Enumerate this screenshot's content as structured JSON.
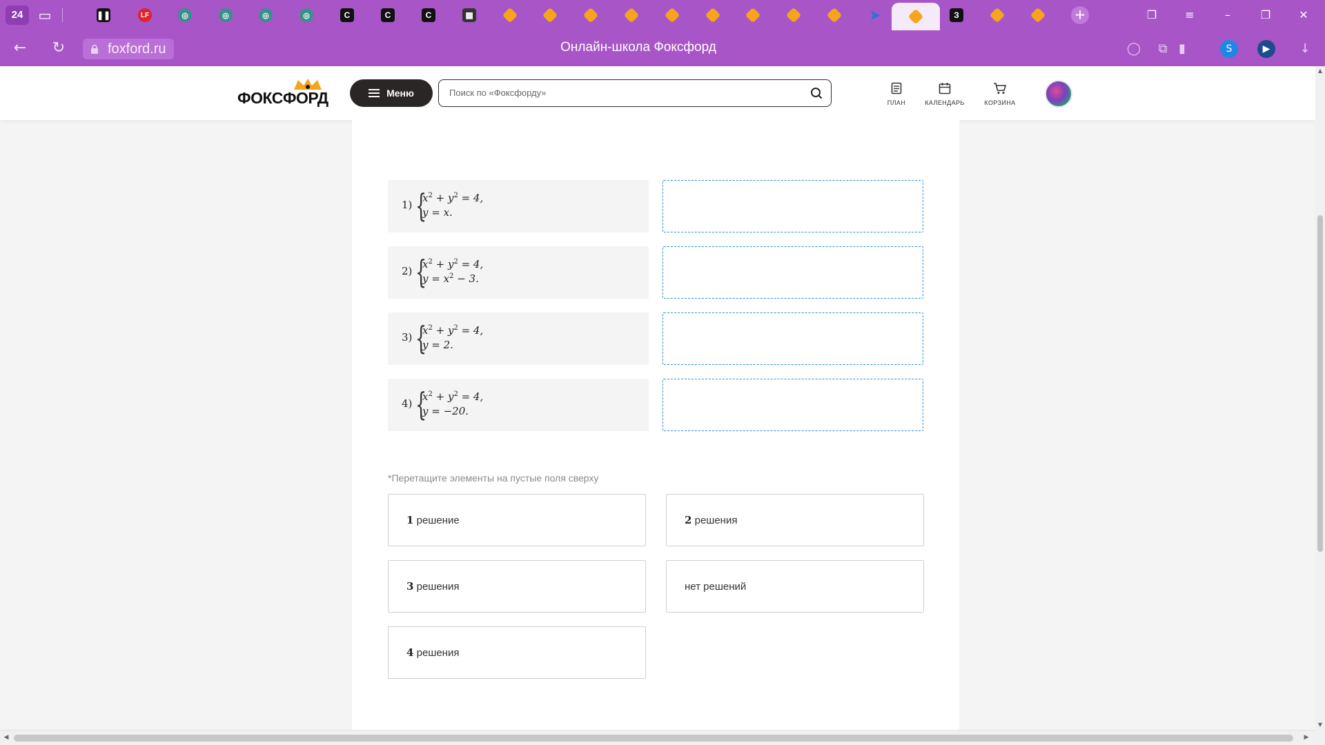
{
  "browser": {
    "tab_count": "24",
    "favicon_letters": {
      "lf": "LF",
      "c": "C",
      "z": "З"
    },
    "url": "foxford.ru",
    "page_title": "Онлайн-школа Фоксфорд"
  },
  "site": {
    "logo_text": "ФОКСФОРД",
    "menu_label": "Меню",
    "search_placeholder": "Поиск по «Фоксфорду»",
    "nav": {
      "plan": "ПЛАН",
      "calendar": "КАЛЕНДАРЬ",
      "cart": "КОРЗИНА"
    }
  },
  "task": {
    "systems": [
      {
        "num": "1)",
        "eq1_a": "x",
        "eq1_b": " + y",
        "eq1_c": " = 4,",
        "eq2": "y = x."
      },
      {
        "num": "2)",
        "eq1_a": "x",
        "eq1_b": " + y",
        "eq1_c": " = 4,",
        "eq2_a": "y = x",
        "eq2_b": " − 3."
      },
      {
        "num": "3)",
        "eq1_a": "x",
        "eq1_b": " + y",
        "eq1_c": " = 4,",
        "eq2": "y = 2."
      },
      {
        "num": "4)",
        "eq1_a": "x",
        "eq1_b": " + y",
        "eq1_c": " = 4,",
        "eq2": "y = −20."
      }
    ],
    "exponent": "2",
    "hint": "*Перетащите элементы на пустые поля сверху",
    "options": [
      {
        "num": "1",
        "text": " решение"
      },
      {
        "num": "2",
        "text": " решения"
      },
      {
        "num": "3",
        "text": " решения"
      },
      {
        "num": "",
        "text": "нет решений"
      },
      {
        "num": "4",
        "text": " решения"
      }
    ]
  }
}
